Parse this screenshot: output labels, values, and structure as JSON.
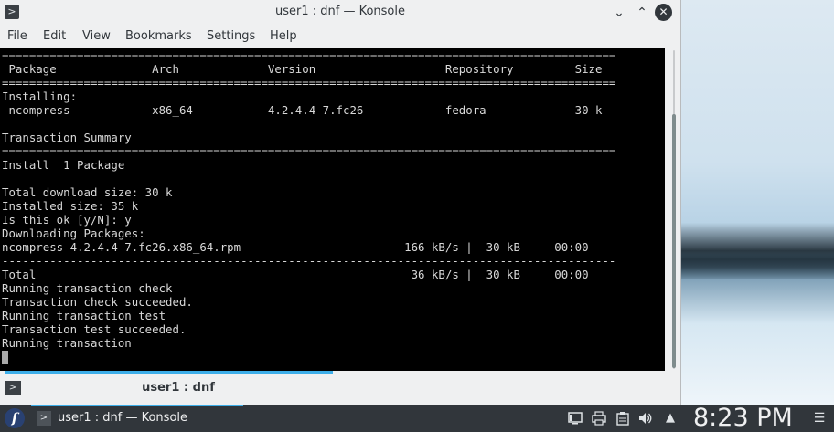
{
  "window": {
    "title": "user1 : dnf — Konsole",
    "app_icon": "terminal-icon",
    "buttons": {
      "minimize": "minimize-icon",
      "maximize": "maximize-icon",
      "close": "close-icon"
    }
  },
  "menubar": {
    "items": [
      "File",
      "Edit",
      "View",
      "Bookmarks",
      "Settings",
      "Help"
    ]
  },
  "terminal": {
    "lines": [
      "==========================================================================================",
      " Package              Arch             Version                   Repository         Size",
      "==========================================================================================",
      "Installing:",
      " ncompress            x86_64           4.2.4.4-7.fc26            fedora             30 k",
      "",
      "Transaction Summary",
      "==========================================================================================",
      "Install  1 Package",
      "",
      "Total download size: 30 k",
      "Installed size: 35 k",
      "Is this ok [y/N]: y",
      "Downloading Packages:",
      "ncompress-4.2.4.4-7.fc26.x86_64.rpm                        166 kB/s |  30 kB     00:00",
      "------------------------------------------------------------------------------------------",
      "Total                                                       36 kB/s |  30 kB     00:00",
      "Running transaction check",
      "Transaction check succeeded.",
      "Running transaction test",
      "Transaction test succeeded.",
      "Running transaction"
    ]
  },
  "tabbar": {
    "tab_label": "user1 : dnf"
  },
  "taskbar": {
    "launcher_icon": "fedora-launcher-icon",
    "task_label": "user1 : dnf — Konsole",
    "tray_icons": [
      "display-icon",
      "printer-icon",
      "clipboard-icon",
      "volume-icon",
      "expand-arrow-icon"
    ],
    "clock": "8:23 PM",
    "menu_icon": "hamburger-icon"
  },
  "colors": {
    "accent": "#3daee9",
    "terminal_bg": "#000000",
    "terminal_fg": "#d8d8d8",
    "taskbar_bg": "#31363b",
    "window_bg": "#eff0f1"
  }
}
